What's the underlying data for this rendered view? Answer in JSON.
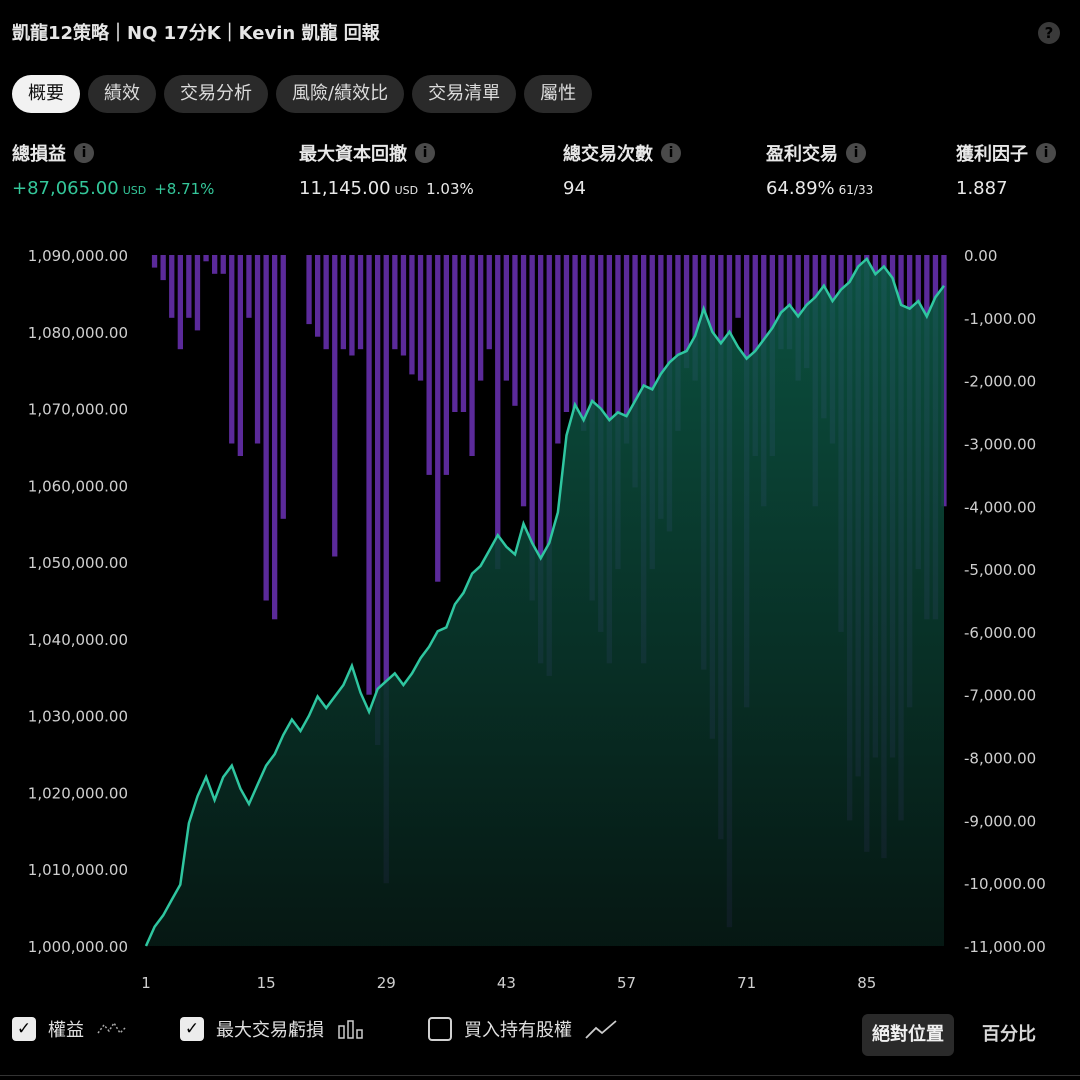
{
  "header": {
    "title": "凱龍12策略｜NQ 17分K｜Kevin 凱龍 回報",
    "help_icon": "?"
  },
  "tabs": [
    {
      "label": "概要",
      "active": true
    },
    {
      "label": "績效",
      "active": false
    },
    {
      "label": "交易分析",
      "active": false
    },
    {
      "label": "風險/績效比",
      "active": false
    },
    {
      "label": "交易清單",
      "active": false
    },
    {
      "label": "屬性",
      "active": false
    }
  ],
  "stats": {
    "net_profit": {
      "label": "總損益",
      "value": "+87,065.00",
      "unit": "USD",
      "pct": "+8.71%"
    },
    "max_drawdown": {
      "label": "最大資本回撤",
      "value": "11,145.00",
      "unit": "USD",
      "pct": "1.03%"
    },
    "total_trades": {
      "label": "總交易次數",
      "value": "94"
    },
    "profitable": {
      "label": "盈利交易",
      "value": "64.89%",
      "sub": "61/33"
    },
    "profit_factor": {
      "label": "獲利因子",
      "value": "1.887"
    }
  },
  "colors": {
    "equity_line": "#2fc6a0",
    "equity_fill_top": "#0d5a47",
    "equity_fill_bottom": "#061a15",
    "drawdown_bar": "#5b2a9a",
    "positive": "#34c79a"
  },
  "chart_data": {
    "type": "area",
    "x_ticks": [
      1,
      15,
      29,
      43,
      57,
      71,
      85
    ],
    "left_axis": {
      "ticks": [
        "1,090,000.00",
        "1,080,000.00",
        "1,070,000.00",
        "1,060,000.00",
        "1,050,000.00",
        "1,040,000.00",
        "1,030,000.00",
        "1,020,000.00",
        "1,010,000.00",
        "1,000,000.00"
      ],
      "ylim": [
        1000000,
        1090000
      ]
    },
    "right_axis": {
      "ticks": [
        "0.00",
        "-1,000.00",
        "-2,000.00",
        "-3,000.00",
        "-4,000.00",
        "-5,000.00",
        "-6,000.00",
        "-7,000.00",
        "-8,000.00",
        "-9,000.00",
        "-10,000.00",
        "-11,000.00"
      ],
      "ylim": [
        -11000,
        0
      ]
    },
    "series": [
      {
        "name": "權益",
        "type": "line",
        "values": [
          1000000,
          1002500,
          1004000,
          1006000,
          1008000,
          1016000,
          1019500,
          1022000,
          1019000,
          1022000,
          1023500,
          1020500,
          1018500,
          1021000,
          1023500,
          1025000,
          1027500,
          1029500,
          1028000,
          1030000,
          1032500,
          1031000,
          1032500,
          1034000,
          1036500,
          1033000,
          1030500,
          1033500,
          1034500,
          1035500,
          1034000,
          1035500,
          1037500,
          1039000,
          1041000,
          1041500,
          1044500,
          1046000,
          1048500,
          1049500,
          1051500,
          1053500,
          1052000,
          1051000,
          1055000,
          1052500,
          1050500,
          1052500,
          1056500,
          1066500,
          1070500,
          1068500,
          1071000,
          1070000,
          1068500,
          1069500,
          1069000,
          1071000,
          1073000,
          1072500,
          1074500,
          1076000,
          1077000,
          1077500,
          1079500,
          1083000,
          1080000,
          1078500,
          1080000,
          1078000,
          1076500,
          1077500,
          1079000,
          1080500,
          1082500,
          1083500,
          1082000,
          1083500,
          1084500,
          1086000,
          1084000,
          1085500,
          1086500,
          1088500,
          1089500,
          1087500,
          1088500,
          1087000,
          1083500,
          1083000,
          1084000,
          1082000,
          1084500,
          1086000
        ],
        "color": "#2fc6a0"
      },
      {
        "name": "最大交易虧損",
        "type": "bar",
        "values": [
          0,
          -200,
          -400,
          -1000,
          -1500,
          -1000,
          -1200,
          -100,
          -300,
          -300,
          -3000,
          -3200,
          -1000,
          -3000,
          -5500,
          -5800,
          -4200,
          0,
          0,
          -1100,
          -1300,
          -1500,
          -4800,
          -1500,
          -1600,
          -1500,
          -7000,
          -7800,
          -10000,
          -1500,
          -1600,
          -1900,
          -2000,
          -3500,
          -5200,
          -3500,
          -2500,
          -2500,
          -3200,
          -2000,
          -1500,
          -5000,
          -2000,
          -2400,
          -4000,
          -5500,
          -6500,
          -6700,
          -3000,
          -2500,
          -2500,
          -2800,
          -5500,
          -6000,
          -6500,
          -5000,
          -3000,
          -3700,
          -6500,
          -5000,
          -4200,
          -4400,
          -2800,
          -1800,
          -2000,
          -6600,
          -7700,
          -9300,
          -10700,
          -1000,
          -7200,
          -3200,
          -4000,
          -3200,
          -1500,
          -1500,
          -2000,
          -1800,
          -4000,
          -2600,
          -3000,
          -6000,
          -9000,
          -8300,
          -9500,
          -8000,
          -9600,
          -8000,
          -9000,
          -7200,
          -5000,
          -5800,
          -5800,
          -4000
        ],
        "color": "#5b2a9a"
      }
    ]
  },
  "legend": {
    "equity": {
      "label": "權益",
      "checked": true
    },
    "drawdown": {
      "label": "最大交易虧損",
      "checked": true
    },
    "buy_hold": {
      "label": "買入持有股權",
      "checked": false
    }
  },
  "mode": {
    "absolute": "絕對位置",
    "percent": "百分比"
  }
}
